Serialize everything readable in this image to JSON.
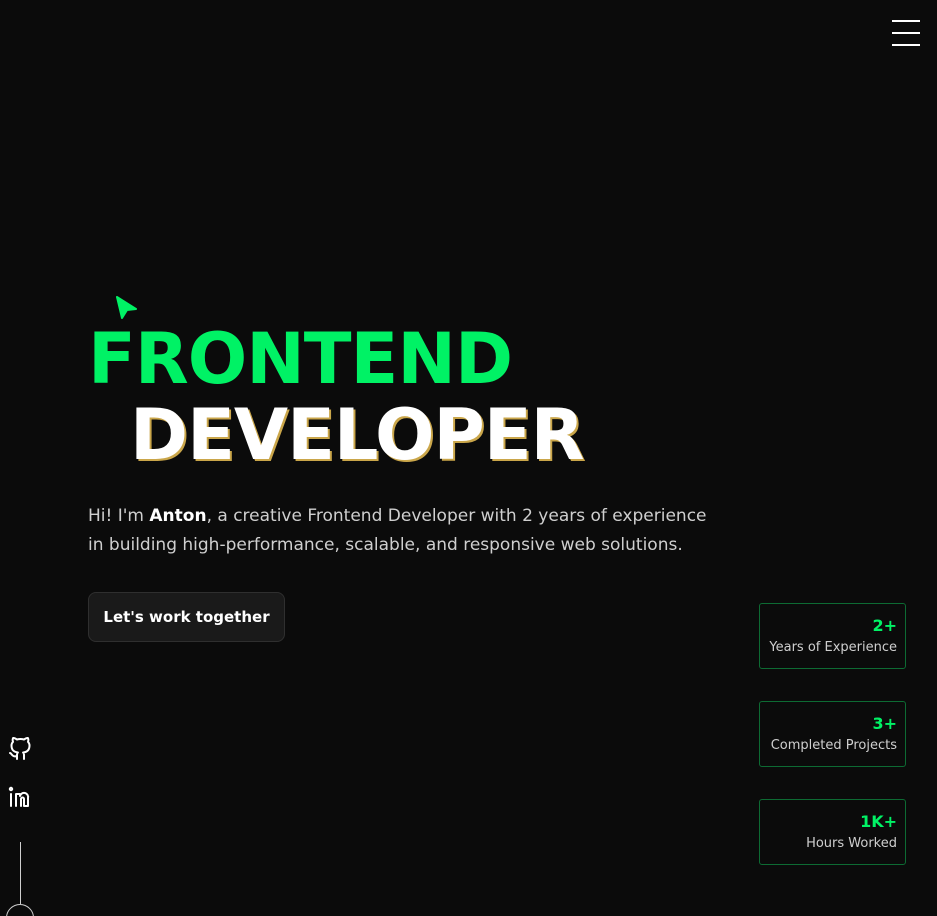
{
  "header": {
    "menu_icon": "hamburger-menu-icon"
  },
  "hero": {
    "cursor_icon": "cursor-arrow-icon",
    "title_line1": "FRONTEND",
    "title_line2": "DEVELOPER",
    "intro_prefix": "Hi! I'm ",
    "intro_name": "Anton",
    "intro_suffix": ", a creative Frontend Developer with 2 years of experience in building high-performance, scalable, and responsive web solutions.",
    "cta_label": "Let's work together"
  },
  "stats": [
    {
      "value": "2+",
      "label": "Years of Experience"
    },
    {
      "value": "3+",
      "label": "Completed Projects"
    },
    {
      "value": "1K+",
      "label": "Hours Worked"
    }
  ],
  "social": {
    "github_icon": "github-icon",
    "linkedin_icon": "linkedin-icon"
  },
  "colors": {
    "background": "#0b0b0b",
    "accent": "#00f265",
    "text": "#ffffff",
    "muted_text": "#cfcfcf",
    "stat_border": "#0d6b33"
  }
}
